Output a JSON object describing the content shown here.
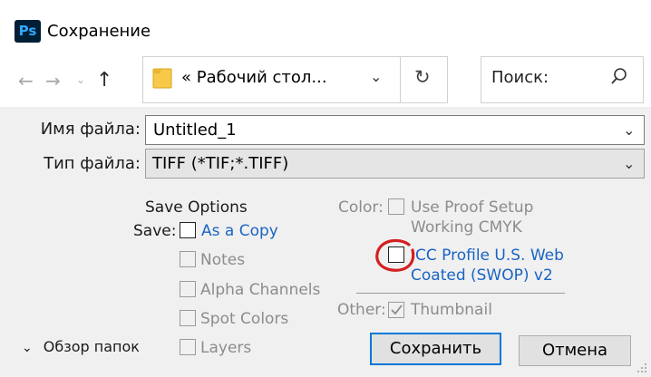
{
  "window": {
    "app_logo": "Ps",
    "title": "Сохранение"
  },
  "nav": {
    "back_icon": "arrow-left-icon",
    "forward_icon": "arrow-right-icon",
    "up_icon": "arrow-up-icon",
    "address": "« Рабочий стол...",
    "search_placeholder": "Поиск:"
  },
  "form": {
    "filename_label": "Имя файла:",
    "filename_value": "Untitled_1",
    "filetype_label": "Тип файла:",
    "filetype_value": "TIFF (*TIF;*.TIFF)"
  },
  "save_options": {
    "title": "Save Options",
    "save_label": "Save:",
    "as_copy": "As a Copy",
    "notes": "Notes",
    "alpha_channels": "Alpha Channels",
    "spot_colors": "Spot Colors",
    "layers": "Layers",
    "color_label": "Color:",
    "use_proof_setup": "Use Proof Setup\nWorking CMYK",
    "icc_profile": "ICC Profile U.S. Web\nCoated (SWOP) v2",
    "other_label": "Other:",
    "thumbnail": "Thumbnail",
    "thumbnail_checked": true,
    "as_copy_checked": false,
    "icc_checked": false
  },
  "footer": {
    "browse_folders": "Обзор папок",
    "save_button": "Сохранить",
    "cancel_button": "Отмена"
  },
  "colors": {
    "link_blue": "#1a64c4",
    "accent_border": "#0078d7",
    "annotation_red": "#d42020",
    "ps_logo_bg": "#001e36",
    "ps_logo_fg": "#31a8ff"
  }
}
